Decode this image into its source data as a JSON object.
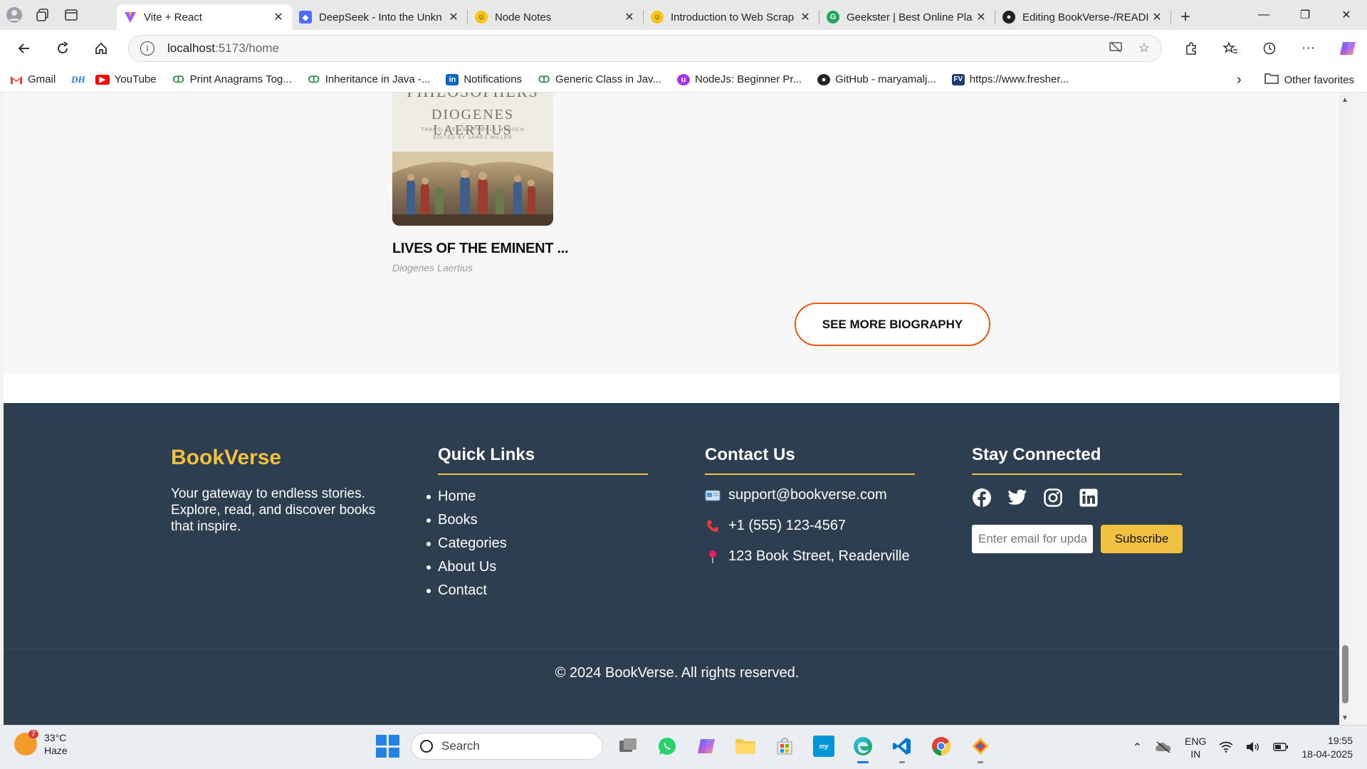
{
  "browser": {
    "tabs": [
      {
        "title": "Vite + React",
        "favicon": "vite-icon",
        "color": "#a259ff",
        "active": true
      },
      {
        "title": "DeepSeek - Into the Unkn",
        "favicon": "deepseek-icon",
        "color": "#4d6bfe",
        "active": false
      },
      {
        "title": "Node Notes",
        "favicon": "smiley-icon",
        "color": "#f5c518",
        "active": false
      },
      {
        "title": "Introduction to Web Scrap",
        "favicon": "smiley-icon",
        "color": "#f5c518",
        "active": false
      },
      {
        "title": "Geekster | Best Online Pla",
        "favicon": "geekster-icon",
        "color": "#22a65a",
        "active": false
      },
      {
        "title": "Editing BookVerse-/READI",
        "favicon": "github-icon",
        "color": "#222222",
        "active": false
      }
    ],
    "url_host": "localhost",
    "url_path": ":5173/home",
    "bookmarks": [
      {
        "label": "Gmail",
        "icon": "gmail-icon",
        "color": "#ea4335"
      },
      {
        "label": "",
        "icon": "dh-icon",
        "color": "#1a73e8",
        "text": "DH"
      },
      {
        "label": "YouTube",
        "icon": "youtube-icon",
        "color": "#ff0000"
      },
      {
        "label": "Print Anagrams Tog...",
        "icon": "gfg-icon",
        "color": "#2f8d46"
      },
      {
        "label": "Inheritance in Java -...",
        "icon": "gfg-icon",
        "color": "#2f8d46"
      },
      {
        "label": "Notifications",
        "icon": "linkedin-icon",
        "color": "#0a66c2"
      },
      {
        "label": "Generic Class in Jav...",
        "icon": "gfg-icon",
        "color": "#2f8d46"
      },
      {
        "label": "NodeJs: Beginner Pr...",
        "icon": "udemy-icon",
        "color": "#a435f0"
      },
      {
        "label": "GitHub - maryamalj...",
        "icon": "github-icon",
        "color": "#222222"
      },
      {
        "label": "https://www.fresher...",
        "icon": "fv-icon",
        "color": "#1f3b73"
      }
    ],
    "other_favorites": "Other favorites"
  },
  "books": {
    "cover_lines": [
      "PHILOSOPHERS",
      "DIOGENES LAERTIUS"
    ],
    "cover_small": [
      "TRANSLATED BY PAMELA MENSCH",
      "EDITED BY JAMES MILLER"
    ],
    "title": "LIVES OF THE EMINENT ...",
    "author": "Diogenes Laertius",
    "see_more": "SEE MORE BIOGRAPHY"
  },
  "footer": {
    "brand": "BookVerse",
    "tagline": "Your gateway to endless stories. Explore, read, and discover books that inspire.",
    "quick_links_title": "Quick Links",
    "quick_links": [
      "Home",
      "Books",
      "Categories",
      "About Us",
      "Contact"
    ],
    "contact_title": "Contact Us",
    "contact": {
      "email": "support@bookverse.com",
      "phone": "+1 (555) 123-4567",
      "address": "123 Book Street, Readerville"
    },
    "stay_title": "Stay Connected",
    "social": [
      "facebook-icon",
      "twitter-icon",
      "instagram-icon",
      "linkedin-icon"
    ],
    "subscribe_placeholder": "Enter email for updates",
    "subscribe_label": "Subscribe",
    "copyright": "© 2024 BookVerse. All rights reserved.",
    "accent": "#f0c040",
    "background": "#2c3e50"
  },
  "taskbar": {
    "temperature": "33°C",
    "condition": "Haze",
    "weather_badge": "7",
    "search_label": "Search",
    "lang_top": "ENG",
    "lang_bottom": "IN",
    "time": "19:55",
    "date": "18-04-2025"
  }
}
